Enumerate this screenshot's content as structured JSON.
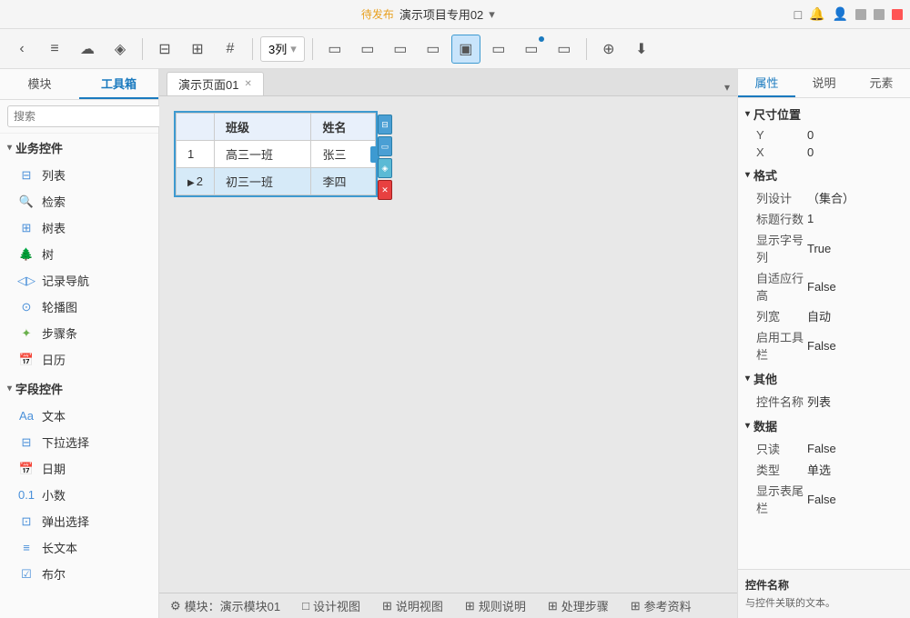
{
  "titlebar": {
    "status": "待发布",
    "project": "演示项目专用02",
    "dropdown_icon": "▾"
  },
  "toolbar": {
    "back_label": "‹",
    "menu_label": "≡",
    "cloud_label": "☁",
    "layers_label": "◈",
    "layout_label": "⊟",
    "grid_label": "⊞",
    "hash_label": "#",
    "col_select": "3列",
    "frame1": "▭",
    "frame2": "▭",
    "frame3": "▭",
    "frame4": "▭",
    "frame5": "▣",
    "frame6": "▭",
    "frame7": "▭",
    "frame8": "▭",
    "share_label": "⊕"
  },
  "left_panel": {
    "tab1": "模块",
    "tab2": "工具箱",
    "search_placeholder": "搜索",
    "categories": [
      {
        "name": "业务控件",
        "items": [
          {
            "icon": "list",
            "label": "列表"
          },
          {
            "icon": "search",
            "label": "检索"
          },
          {
            "icon": "tree-list",
            "label": "树表"
          },
          {
            "icon": "tree",
            "label": "树"
          },
          {
            "icon": "nav",
            "label": "记录导航"
          },
          {
            "icon": "carousel",
            "label": "轮播图"
          },
          {
            "icon": "steps",
            "label": "步骤条"
          },
          {
            "icon": "calendar",
            "label": "日历"
          }
        ]
      },
      {
        "name": "字段控件",
        "items": [
          {
            "icon": "text",
            "label": "文本"
          },
          {
            "icon": "select",
            "label": "下拉选择"
          },
          {
            "icon": "date",
            "label": "日期"
          },
          {
            "icon": "decimal",
            "label": "小数"
          },
          {
            "icon": "popup",
            "label": "弹出选择"
          },
          {
            "icon": "longtext",
            "label": "长文本"
          },
          {
            "icon": "bool",
            "label": "布尔"
          }
        ]
      }
    ]
  },
  "canvas": {
    "page_tab": "演示页面01",
    "table": {
      "headers": [
        "班级",
        "姓名"
      ],
      "rows": [
        {
          "num": "1",
          "arrow": "",
          "cells": [
            "高三一班",
            "张三"
          ]
        },
        {
          "num": "2",
          "arrow": "▶",
          "cells": [
            "初三一班",
            "李四"
          ]
        }
      ]
    }
  },
  "status_bar": {
    "module": "⚙ 模块：演示模块01",
    "design_view": "□ 设计视图",
    "explain_view": "⊞ 说明视图",
    "rule_explain": "⊞ 规则说明",
    "process_steps": "⊞ 处理步骤",
    "ref_info": "⊞ 参考资料"
  },
  "right_panel": {
    "tabs": [
      "属性",
      "说明",
      "元素"
    ],
    "sections": [
      {
        "title": "尺寸位置",
        "props": [
          {
            "label": "Y",
            "value": "0"
          },
          {
            "label": "X",
            "value": "0"
          }
        ]
      },
      {
        "title": "格式",
        "props": [
          {
            "label": "列设计",
            "value": "（集合）"
          },
          {
            "label": "标题行数",
            "value": "1"
          },
          {
            "label": "显示字号列",
            "value": "True"
          },
          {
            "label": "自适应行高",
            "value": "False"
          },
          {
            "label": "列宽",
            "value": "自动"
          },
          {
            "label": "启用工具栏",
            "value": "False"
          }
        ]
      },
      {
        "title": "其他",
        "props": [
          {
            "label": "控件名称",
            "value": "列表"
          }
        ]
      },
      {
        "title": "数据",
        "props": [
          {
            "label": "只读",
            "value": "False"
          },
          {
            "label": "类型",
            "value": "单选"
          },
          {
            "label": "显示表尾栏",
            "value": "False"
          }
        ]
      }
    ],
    "footer_title": "控件名称",
    "footer_desc": "与控件关联的文本。"
  }
}
